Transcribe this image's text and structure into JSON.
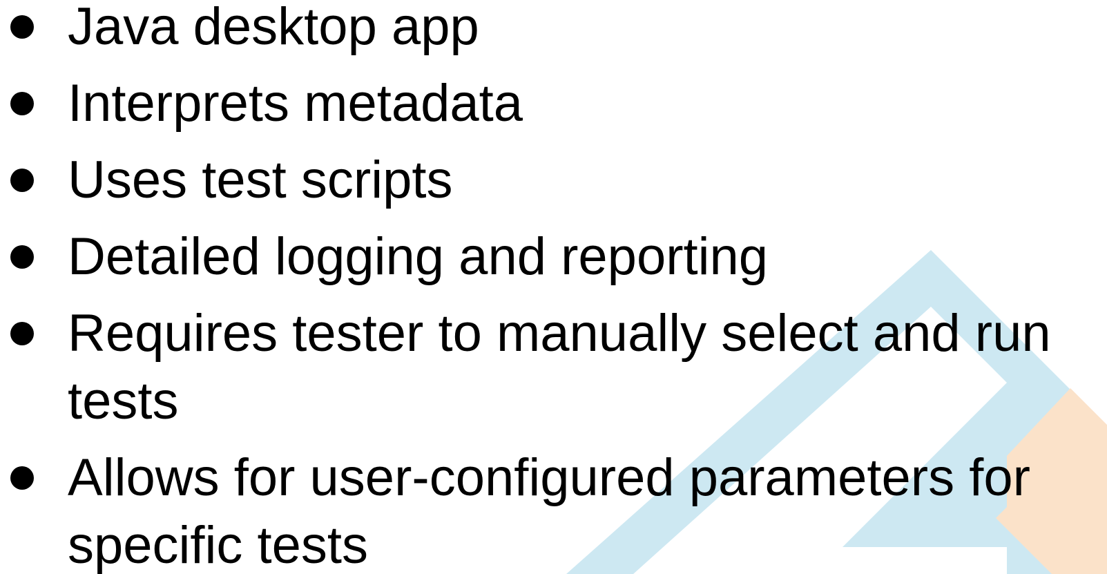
{
  "slide": {
    "colors": {
      "text": "#000000",
      "accent_blue": "#cde8f2",
      "accent_orange": "#fbe2c9"
    },
    "bullet_icon": "bullet-dot-icon",
    "bullets": [
      "Java desktop app",
      "Interprets metadata",
      "Uses test scripts",
      "Detailed logging and reporting",
      "Requires tester to manually select and run tests",
      "Allows for user-configured parameters for specific tests"
    ]
  }
}
